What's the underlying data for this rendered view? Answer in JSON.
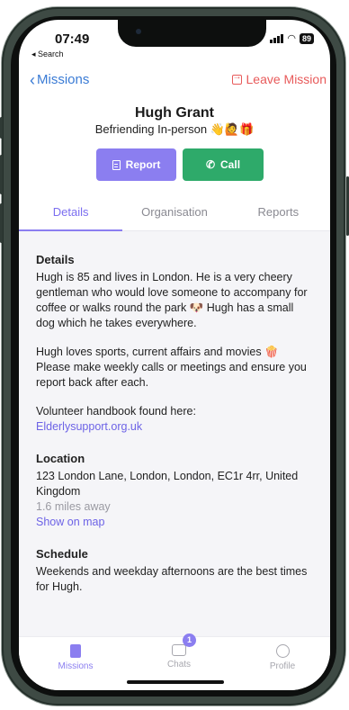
{
  "status": {
    "time": "07:49",
    "back_app": "◂ Search",
    "battery": "89"
  },
  "nav": {
    "back_label": "Missions",
    "leave_label": "Leave Mission"
  },
  "profile": {
    "name": "Hugh Grant",
    "subtitle": "Befriending In-person 👋🙋🎁"
  },
  "actions": {
    "report_label": "Report",
    "call_label": "Call"
  },
  "tabs": [
    {
      "label": "Details",
      "active": true
    },
    {
      "label": "Organisation",
      "active": false
    },
    {
      "label": "Reports",
      "active": false
    }
  ],
  "details": {
    "heading": "Details",
    "para1": "Hugh is 85 and lives in London. He is a very cheery gentleman who would love someone to accompany for coffee or walks round the park 🐶 Hugh has a small dog which he takes everywhere.",
    "para2": "Hugh loves sports, current affairs and movies 🍿 Please make weekly calls or meetings and ensure you report back after each.",
    "handbook_text": "Volunteer handbook found here:",
    "handbook_link": "Elderlysupport.org.uk"
  },
  "location": {
    "heading": "Location",
    "address": "123 London Lane, London, London, EC1r 4rr, United Kingdom",
    "distance": "1.6 miles away",
    "map_link": "Show on map"
  },
  "schedule": {
    "heading": "Schedule",
    "text": "Weekends and weekday afternoons are the best times for Hugh."
  },
  "tabbar": {
    "missions_label": "Missions",
    "chats_label": "Chats",
    "chats_badge": "1",
    "profile_label": "Profile"
  },
  "colors": {
    "accent": "#8b7ef0",
    "call": "#2eaa6a",
    "leave": "#e85a5a",
    "link": "#3a7bd5"
  }
}
